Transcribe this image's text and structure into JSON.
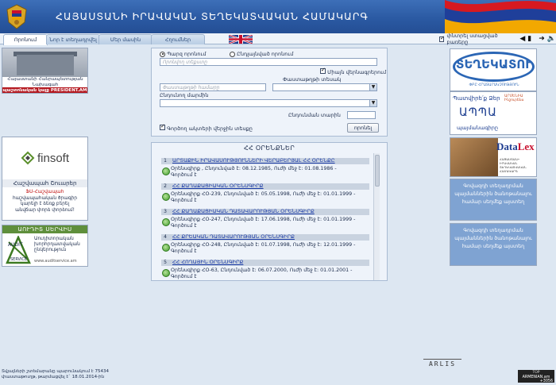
{
  "header": {
    "title": "ՀԱՅԱՍՏԱՆԻ ԻՐԱՎԱԿԱՆ ՏԵՂԵԿԱՏՎԱԿԱՆ ՀԱՄԱԿԱՐԳ"
  },
  "tabs": [
    {
      "label": "Որոնում"
    },
    {
      "label": "Նոր է տեղադրվել"
    },
    {
      "label": "Մեր մասին"
    },
    {
      "label": "Հղումներ"
    }
  ],
  "toolbar": {
    "search_in_results_label": "փնտրել ստացված բառերը",
    "search_in_results_checked": true
  },
  "search": {
    "radio_simple": "Պարզ որոնում",
    "radio_advanced": "Ընդլայնված որոնում",
    "simple_selected": true,
    "query_placeholder": "Որոնվող տեքստը",
    "exact_match_label": "Միայն վերնագրերում",
    "exact_match_checked": true,
    "doc_number_placeholder": "Փաստաթղթի համարը",
    "doc_type_label": "Փաստաթղթի տեսակ",
    "adopting_body_label": "Ընդունող մարմին",
    "adopted_year_label": "Ընդունման տարին",
    "in_force_label": "Գործող ակտերի վերջին տեսքը",
    "in_force_checked": true,
    "submit_label": "որոնել"
  },
  "laws": {
    "heading": "ՀՀ ՕՐԵՆՔՆԵՐ",
    "items": [
      {
        "num": "1",
        "title": "ԱՐՏԱՔԻՆ ԻՐԱՎԱՍՈՒԹՅՈՒՆՆԵՐԻ ՎԵՐԱԲԵՐՅԱԼ ՀՀ ՕՐԵՆՔԸ",
        "meta": "Օրենսգիրք    ,    Ընդունված է: 08.12.1985,    Ուժի մեջ է: 01.08.1986 -",
        "status": "Գործում է"
      },
      {
        "num": "2",
        "title": "ՀՀ ՔԱՂԱՔԱՑԻԱԿԱՆ ՕՐԵՆՍԳԻՐՔ",
        "meta": "Օրենսգիրք    ՀՕ-239,    Ընդունված է: 05.05.1998,    Ուժի մեջ է: 01.01.1999 -",
        "status": "Գործում է"
      },
      {
        "num": "3",
        "title": "ՀՀ ՔԱՂԱՔԱՑԻԱԿԱՆ ԴԱՏԱՎԱՐՈՒԹՅԱՆ ՕՐԵՆՍԳԻՐՔ",
        "meta": "Օրենսգիրք    ՀՕ-247,    Ընդունված է: 17.06.1998,    Ուժի մեջ է: 01.01.1999 -",
        "status": "Գործում է"
      },
      {
        "num": "4",
        "title": "ՀՀ ՔՐԵԱԿԱՆ ԴԱՏԱՎԱՐՈՒԹՅԱՆ ՕՐԵՆՍԳԻՐՔ",
        "meta": "Օրենսգիրք    ՀՕ-248,    Ընդունված է: 01.07.1998,    Ուժի մեջ է: 12.01.1999 -",
        "status": "Գործում է"
      },
      {
        "num": "5",
        "title": "ՀՀ ՀՈՂԱՅԻՆ ՕՐԵՆՍԳԻՐՔ",
        "meta": "Օրենսգիրք    ՀՕ-63,    Ընդունված է: 06.07.2000,    Ուժի մեջ է: 01.01.2001 -",
        "status": "Գործում է"
      }
    ]
  },
  "left_banners": {
    "president_caption": "Հայաստանի Հանրապետության Նախագահ",
    "president_strip": "պաշտոնական կայք  PRESIDENT.AM",
    "finsoft_brand": "finsoft",
    "finsoft_subtitle": "Հաշվապահ Շուարեր",
    "finsoft_line1": "ՖՍ-Հաշվապահ",
    "finsoft_line2": "հաշվապահական ծրագիր",
    "finsoft_line3": "կարելի է ձեռք բերել",
    "finsoft_line4": "անվճար փորձ փորձում!",
    "audit_header": "ԱՈՒԴԻՏ ՍԵՐՎԻՍ",
    "audit_logo_top": "AUDIT",
    "audit_logo_bottom": "SERVICE",
    "audit_text": "Աուդիտորական խորհրդատվական ընկերություն",
    "audit_url": "www.auditservice.am"
  },
  "right_banners": {
    "tegekatu": "ՏԵՂԵԿԱՏՈՒ",
    "tegekatu_sub": "ՓԲԸ ՀՐԱՏԱՐԱԿՉՈՒԹՅՈՒՆ",
    "insurance_l1": "Պատվիրե՛ք Ձեր",
    "insurance_l2": "ԱՊՊԱ",
    "insurance_l3": "պայմանագիրը",
    "insurance_logo": "ԱՐՄԵՆԻԱ Ինշուրենս",
    "datalex_a": "Data",
    "datalex_b": "Lex",
    "datalex_text": "ՀԱՅԱՍՏԱՆԻ ԻՐԱՎԱԿԱՆ ՏԵՂԵԿԱՏՎԱԿԱՆ ՀԱՄԱԿԱՐԳ",
    "blue1": "Գովազդի տեղադրման պայմաններին ծանոթանալու համար սեղմեք այստեղ",
    "blue2": "Գովազդի տեղադրման պայմաններին ծանոթանալու համար սեղմեք այստեղ"
  },
  "footer": {
    "arlis": "ARLIS",
    "line1": "Տվյալների շտեմարանը պարունակում է 75434",
    "line2": "փաստաթուղթ, թարմացվել է` 18.01.2014-ին",
    "counter_top": "TOP",
    "counter_brand": "ARMENIAN.am",
    "counter_value": "+3056"
  },
  "colors": {
    "header_blue": "#2b5aa3",
    "link_blue": "#1a3aa6",
    "panel_bg": "#eef3fa",
    "page_bg": "#dde7f2",
    "ad_blue": "#7fa3d2"
  }
}
